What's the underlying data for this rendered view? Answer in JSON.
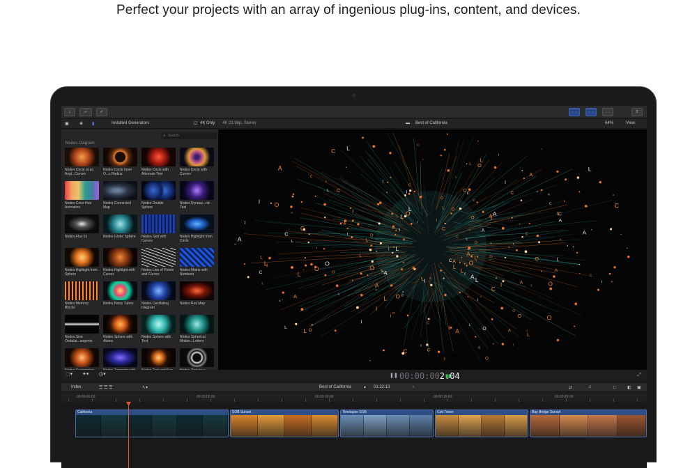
{
  "headline": "Perfect your projects with an array of ingenious plug-ins, content, and devices.",
  "toolbar": {
    "buttons": [
      "",
      "",
      ""
    ]
  },
  "subbar": {
    "generators_label": "Installed Generators",
    "four_k_label": "4K Only",
    "format": "4K 23.98p, Stereo",
    "project_title": "Best of California",
    "zoom": "64%",
    "view_label": "View"
  },
  "browser": {
    "search_placeholder": "Search",
    "section": "Nodes Diagram",
    "tiles": [
      {
        "label": "Nodes Circle at an Angl...Curves",
        "thumb": "orange-burst"
      },
      {
        "label": "Nodes Circle Inner O...c Radius",
        "thumb": "orange-ring"
      },
      {
        "label": "Nodes Circle with Alternate Text",
        "thumb": "red-star"
      },
      {
        "label": "Nodes Circle with Curves",
        "thumb": "multi-ring"
      },
      {
        "label": "Nodes Color Hue Animation",
        "thumb": "color-grid"
      },
      {
        "label": "Nodes Connected Map",
        "thumb": "world-map"
      },
      {
        "label": "Nodes Double Sphere",
        "thumb": "blue-dots"
      },
      {
        "label": "Nodes Dynasp...nd Text",
        "thumb": "purple-burst"
      },
      {
        "label": "Nodes Flux 01",
        "thumb": "white-flux"
      },
      {
        "label": "Nodes Globe Sphere",
        "thumb": "teal-globe"
      },
      {
        "label": "Nodes Grid with Curves",
        "thumb": "blue-grid"
      },
      {
        "label": "Nodes Highlight from Circle",
        "thumb": "blue-button"
      },
      {
        "label": "Nodes Highlight from Sphere",
        "thumb": "orange-sphere"
      },
      {
        "label": "Nodes Highlight with Curves",
        "thumb": "orange-swirl"
      },
      {
        "label": "Nodes Line of Points and Curves",
        "thumb": "white-lines"
      },
      {
        "label": "Nodes Matrix with Numbers",
        "thumb": "blue-matrix"
      },
      {
        "label": "Nodes Memory Blocks",
        "thumb": "orange-blocks"
      },
      {
        "label": "Nodes Noisy Tubes",
        "thumb": "color-tubes"
      },
      {
        "label": "Nodes Oscillating Diagram",
        "thumb": "blue-osc"
      },
      {
        "label": "Nodes Red Map",
        "thumb": "red-map"
      },
      {
        "label": "Nodes Sine Ondulat...angents",
        "thumb": "white-wave"
      },
      {
        "label": "Nodes Sphere with Atoms",
        "thumb": "orange-atoms"
      },
      {
        "label": "Nodes Sphere with Text",
        "thumb": "teal-sphere"
      },
      {
        "label": "Nodes Spherical Motion...Letters",
        "thumb": "teal-letters"
      },
      {
        "label": "Nodes Suspension",
        "thumb": "orange-suspension"
      },
      {
        "label": "Nodes Tangents with Cu...scillator",
        "thumb": "blue-tangents"
      },
      {
        "label": "Nodes Text and Sun",
        "thumb": "orange-sun"
      },
      {
        "label": "Nodes Text on a Spiral",
        "thumb": "white-spiral"
      }
    ]
  },
  "viewer_controls": {
    "timecode_dim": "00:00:00",
    "timecode_bright": "2:04"
  },
  "timeline_bar": {
    "index_label": "Index",
    "project": "Best of California",
    "duration": "01:22:13"
  },
  "ruler": {
    "marks": [
      "00:00:00:00",
      "00:00:05:00",
      "00:00:10:00",
      "00:00:15:00",
      "00:00:20:00"
    ]
  },
  "clips": [
    {
      "title": "California",
      "color": "#2e4f86",
      "frames": [
        "#0d2a33",
        "#14393f",
        "#0d2a33",
        "#14393f",
        "#0d2a33",
        "#14393f"
      ]
    },
    {
      "title": "SOB Sunset",
      "color": "#2e4f86",
      "frames": [
        "#d9822b",
        "#e59a3a",
        "#c86f22",
        "#d98a30"
      ]
    },
    {
      "title": "Timelapse SOB",
      "color": "#2e4f86",
      "frames": [
        "#6a8db5",
        "#7fa0c4",
        "#6a8db5",
        "#5c7fa8"
      ]
    },
    {
      "title": "Coit Tower",
      "color": "#2e4f86",
      "frames": [
        "#c98a40",
        "#e0a352",
        "#b97935",
        "#d99a48"
      ]
    },
    {
      "title": "Bay Bridge Sunset",
      "color": "#2e4f86",
      "frames": [
        "#b8693a",
        "#d68a4f",
        "#c5774a",
        "#9e5530"
      ]
    }
  ],
  "colors": {
    "accent_blue": "#2b4a8c",
    "playhead": "#e05a2b",
    "node_orange": "#e8742c",
    "node_teal": "#2fb7b0"
  }
}
